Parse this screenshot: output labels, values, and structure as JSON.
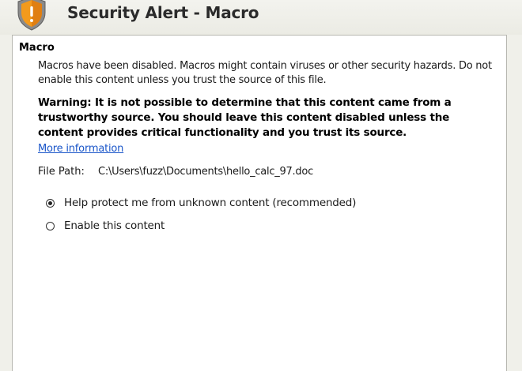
{
  "window": {
    "title": "Security Alert - Macro"
  },
  "section": {
    "title": "Macro",
    "description": "Macros have been disabled. Macros might contain viruses or other security hazards. Do not enable this content unless you trust the source of this file.",
    "warning": "Warning: It is not possible to determine that this content came from a trustworthy source. You should leave this content disabled unless the content provides critical functionality and you trust its source.",
    "more_info_link": "More information",
    "file_path_label": "File Path:",
    "file_path_value": "C:\\Users\\fuzz\\Documents\\hello_calc_97.doc"
  },
  "options": [
    {
      "label": "Help protect me from unknown content (recommended)",
      "selected": true
    },
    {
      "label": "Enable this content",
      "selected": false
    }
  ],
  "icons": {
    "header": "shield-icon"
  },
  "colors": {
    "link": "#1a56c9",
    "shield_orange": "#f39a1c",
    "shield_gray": "#8a8a8a"
  }
}
